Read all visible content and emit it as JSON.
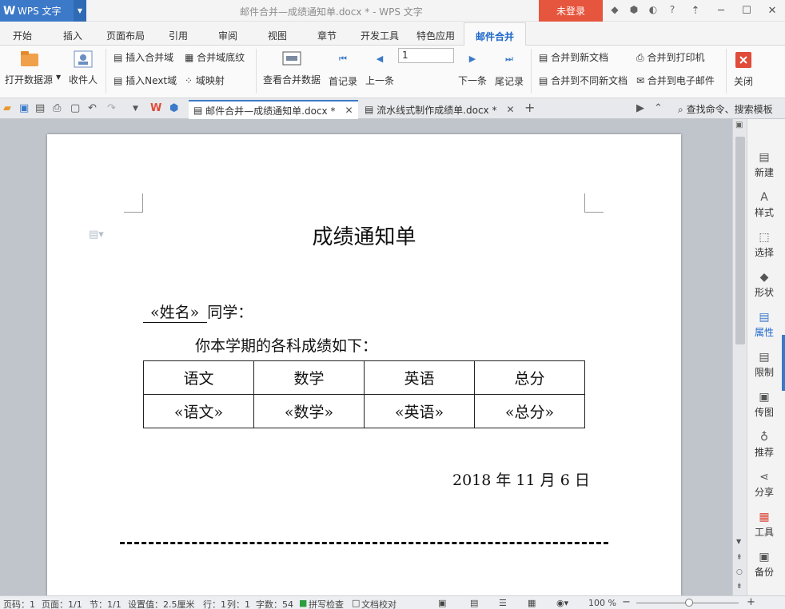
{
  "titlebar": {
    "app_name": "WPS 文字",
    "document_title": "邮件合并—成绩通知单.docx * - WPS 文字",
    "login_label": "未登录",
    "help_label": "?"
  },
  "menu": {
    "tabs": [
      "开始",
      "插入",
      "页面布局",
      "引用",
      "审阅",
      "视图",
      "章节",
      "开发工具",
      "特色应用",
      "邮件合并"
    ],
    "active_tab": "邮件合并"
  },
  "ribbon": {
    "open_datasource": "打开数据源",
    "recipients": "收件人",
    "insert_merge_field": "插入合并域",
    "merge_field_shading": "合并域底纹",
    "insert_next": "插入Next域",
    "field_mapping": "域映射",
    "view_merged_data": "查看合并数据",
    "first_record": "首记录",
    "previous": "上一条",
    "record_number": "1",
    "next": "下一条",
    "last_record": "尾记录",
    "merge_to_new_doc": "合并到新文档",
    "merge_to_separate_docs": "合并到不同新文档",
    "merge_to_printer": "合并到打印机",
    "merge_to_email": "合并到电子邮件",
    "close": "关闭"
  },
  "doc_tabs": [
    {
      "label": "邮件合并—成绩通知单.docx *",
      "active": true
    },
    {
      "label": "流水线式制作成绩单.docx *",
      "active": false
    }
  ],
  "search_label": "查找命令、搜索模板",
  "document": {
    "title": "成绩通知单",
    "name_field": "«姓名»",
    "greeting_suffix": "同学：",
    "intro": "你本学期的各科成绩如下：",
    "table_headers": [
      "语文",
      "数学",
      "英语",
      "总分"
    ],
    "table_fields": [
      "«语文»",
      "«数学»",
      "«英语»",
      "«总分»"
    ],
    "date": "2018 年 11 月 6 日"
  },
  "side_panel": [
    "新建",
    "样式",
    "选择",
    "形状",
    "属性",
    "限制",
    "传图",
    "推荐",
    "分享",
    "工具",
    "备份"
  ],
  "status": {
    "page_no": "页码：1",
    "pages": "页面：1/1",
    "section": "节：1/1",
    "position": "设置值：2.5厘米",
    "row": "行：1",
    "col": "列：1",
    "words": "字数：54",
    "spellcheck": "拼写检查",
    "doc_proof": "文档校对",
    "zoom": "100 %",
    "zoom_fraction": 0.5
  },
  "colors": {
    "brand": "#3c79c8",
    "login": "#e6553d",
    "active_tab_text": "#1c66c9"
  }
}
